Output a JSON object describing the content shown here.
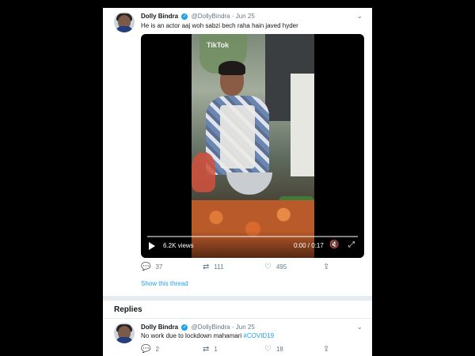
{
  "tweet": {
    "display_name": "Dolly Bindra",
    "handle": "@DollyBindra",
    "separator": "·",
    "date": "Jun 25",
    "text": "He is an actor aaj woh sabzi bech raha hain javed hyder",
    "video": {
      "watermark": "TikTok",
      "views": "6.2K views",
      "time": "0:00 / 0:17"
    },
    "actions": {
      "replies": "37",
      "retweets": "111",
      "likes": "495"
    },
    "thread_link": "Show this thread"
  },
  "replies_header": "Replies",
  "reply": {
    "display_name": "Dolly Bindra",
    "handle": "@DollyBindra",
    "separator": "·",
    "date": "Jun 25",
    "text": "No work due to lockdown mahamari",
    "hashtag": "#COVID19",
    "actions": {
      "replies": "2",
      "retweets": "1",
      "likes": "18"
    }
  },
  "icons": {
    "verified": "verified-badge-icon",
    "reply": "reply-icon",
    "retweet": "retweet-icon",
    "like": "like-icon",
    "share": "share-icon"
  },
  "colors": {
    "accent": "#1da1f2",
    "muted": "#657786",
    "background": "#e6ecf0"
  }
}
